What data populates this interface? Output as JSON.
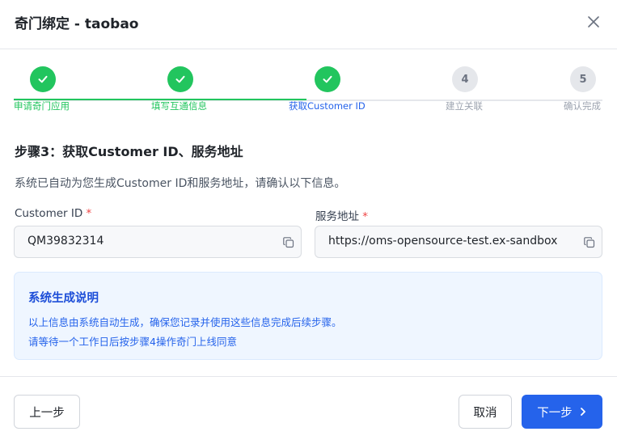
{
  "dialog": {
    "title": "奇门绑定 - taobao"
  },
  "steps": [
    {
      "index": "1",
      "label": "申请奇门应用",
      "status": "done"
    },
    {
      "index": "2",
      "label": "填写互通信息",
      "status": "done"
    },
    {
      "index": "3",
      "label": "获取Customer ID",
      "status": "current"
    },
    {
      "index": "4",
      "label": "建立关联",
      "status": "pending"
    },
    {
      "index": "5",
      "label": "确认完成",
      "status": "pending"
    }
  ],
  "section": {
    "title": "步骤3：获取Customer ID、服务地址",
    "description": "系统已自动为您生成Customer ID和服务地址，请确认以下信息。"
  },
  "fields": {
    "customer_id": {
      "label": "Customer ID",
      "required_mark": "*",
      "value": "QM39832314"
    },
    "service_url": {
      "label": "服务地址",
      "required_mark": "*",
      "value": "https://oms-opensource-test.ex-sandbox"
    }
  },
  "info": {
    "title": "系统生成说明",
    "line1": "以上信息由系统自动生成，确保您记录并使用这些信息完成后续步骤。",
    "line2": "请等待一个工作日后按步骤4操作奇门上线同意"
  },
  "footer": {
    "prev_label": "上一步",
    "cancel_label": "取消",
    "next_label": "下一步"
  },
  "colors": {
    "done": "#22c55e",
    "current": "#2563eb",
    "pending": "#e5e7eb",
    "primary": "#2563eb",
    "required": "#ef4444"
  }
}
